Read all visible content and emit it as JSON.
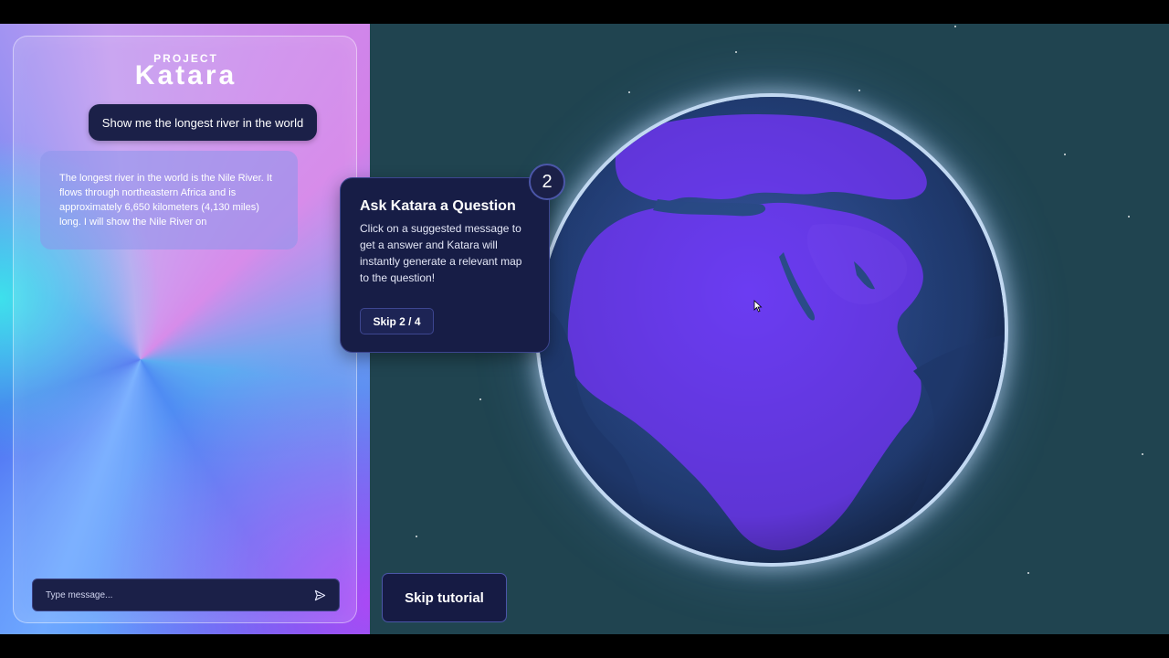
{
  "brand": {
    "top": "PROJECT",
    "name": "Katara"
  },
  "chat": {
    "user_message": "Show me the longest river in the world",
    "bot_message": "The longest river in the world is the Nile River. It flows through northeastern Africa and is approximately 6,650 kilometers (4,130 miles) long. I will show the Nile River on",
    "input_placeholder": "Type message...",
    "send_icon": "send-icon"
  },
  "tutorial": {
    "step": "2",
    "title": "Ask Katara a Question",
    "body": "Click on a suggested message to get a answer and Katara will instantly generate a relevant map to the question!",
    "skip_label": "Skip 2 / 4"
  },
  "skip_tutorial_label": "Skip tutorial",
  "colors": {
    "space": "#204450",
    "panel_dark": "#1b2048",
    "globe_land": "#6b3cf2",
    "globe_glow": "#d8e8ff",
    "gradient_cyan": "#3ce6eb",
    "gradient_purple": "#af46f5"
  },
  "globe": {
    "icon": "globe-icon",
    "region": "Africa and Middle East"
  }
}
